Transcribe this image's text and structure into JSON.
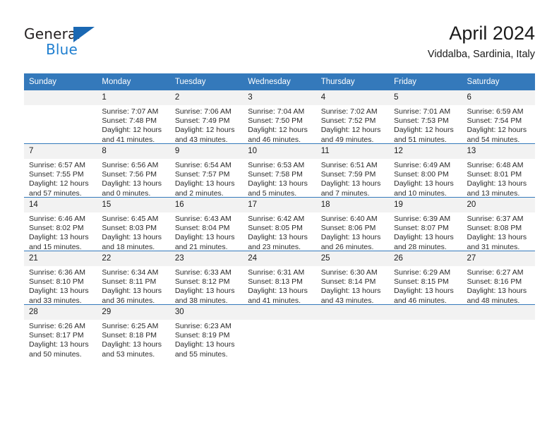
{
  "brand": {
    "name_part1": "General",
    "name_part2": "Blue",
    "triangle_color": "#1a68b3",
    "blue_color": "#1f7fd0"
  },
  "header": {
    "title": "April 2024",
    "subtitle": "Viddalba, Sardinia, Italy"
  },
  "theme": {
    "header_bg": "#3479bb",
    "daynum_bg": "#f2f2f2",
    "row_divider": "#3479bb"
  },
  "weekday_headers": [
    "Sunday",
    "Monday",
    "Tuesday",
    "Wednesday",
    "Thursday",
    "Friday",
    "Saturday"
  ],
  "weeks": [
    [
      {
        "empty": true,
        "day": ""
      },
      {
        "day": "1",
        "sunrise": "Sunrise: 7:07 AM",
        "sunset": "Sunset: 7:48 PM",
        "daylight_line1": "Daylight: 12 hours",
        "daylight_line2": "and 41 minutes."
      },
      {
        "day": "2",
        "sunrise": "Sunrise: 7:06 AM",
        "sunset": "Sunset: 7:49 PM",
        "daylight_line1": "Daylight: 12 hours",
        "daylight_line2": "and 43 minutes."
      },
      {
        "day": "3",
        "sunrise": "Sunrise: 7:04 AM",
        "sunset": "Sunset: 7:50 PM",
        "daylight_line1": "Daylight: 12 hours",
        "daylight_line2": "and 46 minutes."
      },
      {
        "day": "4",
        "sunrise": "Sunrise: 7:02 AM",
        "sunset": "Sunset: 7:52 PM",
        "daylight_line1": "Daylight: 12 hours",
        "daylight_line2": "and 49 minutes."
      },
      {
        "day": "5",
        "sunrise": "Sunrise: 7:01 AM",
        "sunset": "Sunset: 7:53 PM",
        "daylight_line1": "Daylight: 12 hours",
        "daylight_line2": "and 51 minutes."
      },
      {
        "day": "6",
        "sunrise": "Sunrise: 6:59 AM",
        "sunset": "Sunset: 7:54 PM",
        "daylight_line1": "Daylight: 12 hours",
        "daylight_line2": "and 54 minutes."
      }
    ],
    [
      {
        "day": "7",
        "sunrise": "Sunrise: 6:57 AM",
        "sunset": "Sunset: 7:55 PM",
        "daylight_line1": "Daylight: 12 hours",
        "daylight_line2": "and 57 minutes."
      },
      {
        "day": "8",
        "sunrise": "Sunrise: 6:56 AM",
        "sunset": "Sunset: 7:56 PM",
        "daylight_line1": "Daylight: 13 hours",
        "daylight_line2": "and 0 minutes."
      },
      {
        "day": "9",
        "sunrise": "Sunrise: 6:54 AM",
        "sunset": "Sunset: 7:57 PM",
        "daylight_line1": "Daylight: 13 hours",
        "daylight_line2": "and 2 minutes."
      },
      {
        "day": "10",
        "sunrise": "Sunrise: 6:53 AM",
        "sunset": "Sunset: 7:58 PM",
        "daylight_line1": "Daylight: 13 hours",
        "daylight_line2": "and 5 minutes."
      },
      {
        "day": "11",
        "sunrise": "Sunrise: 6:51 AM",
        "sunset": "Sunset: 7:59 PM",
        "daylight_line1": "Daylight: 13 hours",
        "daylight_line2": "and 7 minutes."
      },
      {
        "day": "12",
        "sunrise": "Sunrise: 6:49 AM",
        "sunset": "Sunset: 8:00 PM",
        "daylight_line1": "Daylight: 13 hours",
        "daylight_line2": "and 10 minutes."
      },
      {
        "day": "13",
        "sunrise": "Sunrise: 6:48 AM",
        "sunset": "Sunset: 8:01 PM",
        "daylight_line1": "Daylight: 13 hours",
        "daylight_line2": "and 13 minutes."
      }
    ],
    [
      {
        "day": "14",
        "sunrise": "Sunrise: 6:46 AM",
        "sunset": "Sunset: 8:02 PM",
        "daylight_line1": "Daylight: 13 hours",
        "daylight_line2": "and 15 minutes."
      },
      {
        "day": "15",
        "sunrise": "Sunrise: 6:45 AM",
        "sunset": "Sunset: 8:03 PM",
        "daylight_line1": "Daylight: 13 hours",
        "daylight_line2": "and 18 minutes."
      },
      {
        "day": "16",
        "sunrise": "Sunrise: 6:43 AM",
        "sunset": "Sunset: 8:04 PM",
        "daylight_line1": "Daylight: 13 hours",
        "daylight_line2": "and 21 minutes."
      },
      {
        "day": "17",
        "sunrise": "Sunrise: 6:42 AM",
        "sunset": "Sunset: 8:05 PM",
        "daylight_line1": "Daylight: 13 hours",
        "daylight_line2": "and 23 minutes."
      },
      {
        "day": "18",
        "sunrise": "Sunrise: 6:40 AM",
        "sunset": "Sunset: 8:06 PM",
        "daylight_line1": "Daylight: 13 hours",
        "daylight_line2": "and 26 minutes."
      },
      {
        "day": "19",
        "sunrise": "Sunrise: 6:39 AM",
        "sunset": "Sunset: 8:07 PM",
        "daylight_line1": "Daylight: 13 hours",
        "daylight_line2": "and 28 minutes."
      },
      {
        "day": "20",
        "sunrise": "Sunrise: 6:37 AM",
        "sunset": "Sunset: 8:08 PM",
        "daylight_line1": "Daylight: 13 hours",
        "daylight_line2": "and 31 minutes."
      }
    ],
    [
      {
        "day": "21",
        "sunrise": "Sunrise: 6:36 AM",
        "sunset": "Sunset: 8:10 PM",
        "daylight_line1": "Daylight: 13 hours",
        "daylight_line2": "and 33 minutes."
      },
      {
        "day": "22",
        "sunrise": "Sunrise: 6:34 AM",
        "sunset": "Sunset: 8:11 PM",
        "daylight_line1": "Daylight: 13 hours",
        "daylight_line2": "and 36 minutes."
      },
      {
        "day": "23",
        "sunrise": "Sunrise: 6:33 AM",
        "sunset": "Sunset: 8:12 PM",
        "daylight_line1": "Daylight: 13 hours",
        "daylight_line2": "and 38 minutes."
      },
      {
        "day": "24",
        "sunrise": "Sunrise: 6:31 AM",
        "sunset": "Sunset: 8:13 PM",
        "daylight_line1": "Daylight: 13 hours",
        "daylight_line2": "and 41 minutes."
      },
      {
        "day": "25",
        "sunrise": "Sunrise: 6:30 AM",
        "sunset": "Sunset: 8:14 PM",
        "daylight_line1": "Daylight: 13 hours",
        "daylight_line2": "and 43 minutes."
      },
      {
        "day": "26",
        "sunrise": "Sunrise: 6:29 AM",
        "sunset": "Sunset: 8:15 PM",
        "daylight_line1": "Daylight: 13 hours",
        "daylight_line2": "and 46 minutes."
      },
      {
        "day": "27",
        "sunrise": "Sunrise: 6:27 AM",
        "sunset": "Sunset: 8:16 PM",
        "daylight_line1": "Daylight: 13 hours",
        "daylight_line2": "and 48 minutes."
      }
    ],
    [
      {
        "day": "28",
        "sunrise": "Sunrise: 6:26 AM",
        "sunset": "Sunset: 8:17 PM",
        "daylight_line1": "Daylight: 13 hours",
        "daylight_line2": "and 50 minutes."
      },
      {
        "day": "29",
        "sunrise": "Sunrise: 6:25 AM",
        "sunset": "Sunset: 8:18 PM",
        "daylight_line1": "Daylight: 13 hours",
        "daylight_line2": "and 53 minutes."
      },
      {
        "day": "30",
        "sunrise": "Sunrise: 6:23 AM",
        "sunset": "Sunset: 8:19 PM",
        "daylight_line1": "Daylight: 13 hours",
        "daylight_line2": "and 55 minutes."
      },
      {
        "empty": true,
        "day": ""
      },
      {
        "empty": true,
        "day": ""
      },
      {
        "empty": true,
        "day": ""
      },
      {
        "empty": true,
        "day": ""
      }
    ]
  ]
}
